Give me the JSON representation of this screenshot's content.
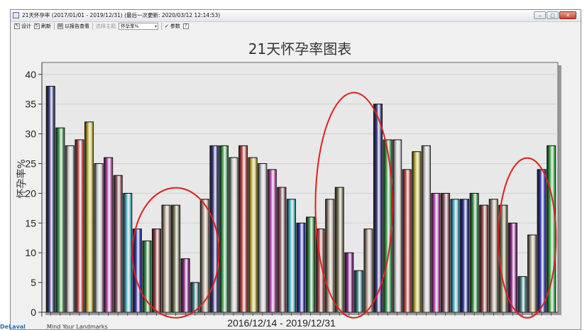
{
  "window": {
    "title": "21天怀孕率 (2017/01/01 - 2019/12/31) (最后一次更新: 2020/03/12 12:14:53)",
    "controls": [
      "‒",
      "▢",
      "✕"
    ]
  },
  "toolbar": {
    "design_label": "设计",
    "refresh_label": "刷新",
    "report_label": "以报告查看",
    "select_topic_label": "选择主题",
    "metric_value": "怀孕率%",
    "params_label": "参数"
  },
  "chart_data": {
    "type": "bar",
    "title": "21天怀孕率图表",
    "xlabel": "2016/12/14 - 2019/12/31",
    "ylabel": "怀孕率%",
    "ylim": [
      0,
      42
    ],
    "yticks": [
      0,
      5,
      10,
      15,
      20,
      25,
      30,
      35,
      40
    ],
    "grid": true,
    "values": [
      38,
      31,
      28,
      29,
      32,
      25,
      26,
      23,
      20,
      14,
      12,
      14,
      18,
      18,
      9,
      5,
      19,
      28,
      28,
      26,
      28,
      26,
      25,
      24,
      21,
      19,
      15,
      16,
      14,
      19,
      21,
      10,
      7,
      14,
      35,
      29,
      29,
      24,
      27,
      28,
      20,
      20,
      19,
      19,
      20,
      18,
      19,
      18,
      15,
      6,
      13,
      24,
      28
    ],
    "colors": [
      "#3a3d80",
      "#3e9a4e",
      "#c8c8c8",
      "#c24848",
      "#c2b232",
      "#c8c8c8",
      "#b848b0",
      "#8a5a64",
      "#48b0c4",
      "#3036a8",
      "#38904a",
      "#984a48",
      "#b0a090",
      "#7c7a58",
      "#8c2a8c",
      "#3e7e82",
      "#b0a090",
      "#3a3d80",
      "#3e9a4e",
      "#c8c8c8",
      "#c24848",
      "#c2b232",
      "#c8c8c8",
      "#b848b0",
      "#8a5a64",
      "#48b0c4",
      "#3036a8",
      "#38904a",
      "#984a48",
      "#b0a090",
      "#7c7a58",
      "#8c2a8c",
      "#3e7e82",
      "#b0a090",
      "#3a3d80",
      "#3e9a4e",
      "#c8c8c8",
      "#c24848",
      "#c2b232",
      "#c8c8c8",
      "#b848b0",
      "#8a5a64",
      "#48b0c4",
      "#3036a8",
      "#38904a",
      "#984a48",
      "#b0a090",
      "#7c7a58",
      "#8c2a8c",
      "#3e7e82",
      "#b0a090",
      "#3036a8",
      "#38b04a"
    ],
    "highlight_color": "#e02020",
    "highlights": [
      {
        "from_bar": 10,
        "to_bar": 16
      },
      {
        "from_bar": 29,
        "to_bar": 34
      },
      {
        "from_bar": 48,
        "to_bar": 51
      }
    ]
  },
  "footer": {
    "brand": "DeLaval",
    "text": "Mind Your Landmarks"
  }
}
